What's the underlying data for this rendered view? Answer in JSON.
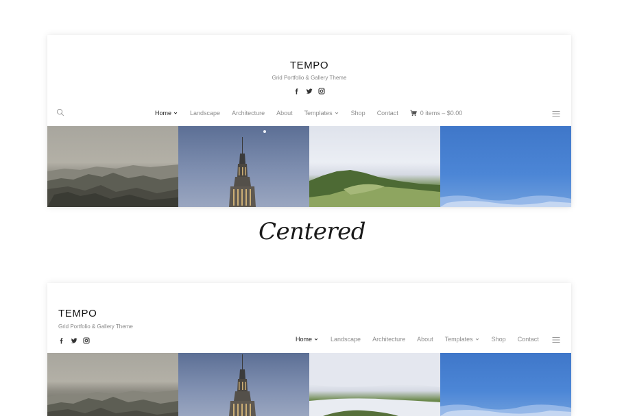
{
  "site": {
    "title": "TEMPO",
    "tagline": "Grid Portfolio & Gallery Theme"
  },
  "nav": {
    "items": [
      {
        "label": "Home",
        "dropdown": true,
        "active": true
      },
      {
        "label": "Landscape",
        "dropdown": false
      },
      {
        "label": "Architecture",
        "dropdown": false
      },
      {
        "label": "About",
        "dropdown": false
      },
      {
        "label": "Templates",
        "dropdown": true
      },
      {
        "label": "Shop",
        "dropdown": false
      },
      {
        "label": "Contact",
        "dropdown": false
      }
    ],
    "cart_label": "0 items – $0.00"
  },
  "socials": [
    "facebook-icon",
    "twitter-icon",
    "instagram-icon"
  ],
  "caption": "Centered",
  "gallery": [
    {
      "name": "landscape-mountains-image"
    },
    {
      "name": "empire-state-building-image"
    },
    {
      "name": "green-hill-clouds-image"
    },
    {
      "name": "blue-sky-image"
    }
  ],
  "colors": {
    "nav_active": "#222222",
    "nav_inactive": "#8c8c8c",
    "sky_blue": "#4c86d6"
  }
}
